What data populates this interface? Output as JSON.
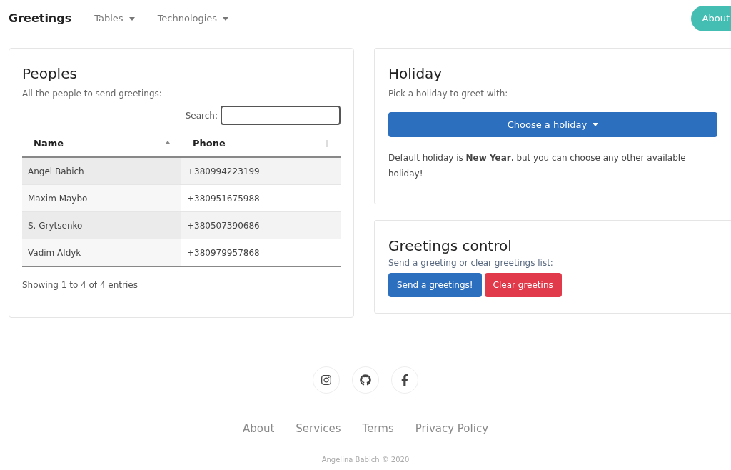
{
  "navbar": {
    "brand": "Greetings",
    "menus": [
      {
        "label": "Tables"
      },
      {
        "label": "Technologies"
      }
    ],
    "about_button": "About"
  },
  "peoples": {
    "title": "Peoples",
    "subtitle": "All the people to send greetings:",
    "search": {
      "label": "Search:"
    },
    "columns": [
      {
        "label": "Name",
        "sorted": true
      },
      {
        "label": "Phone",
        "sorted": false
      }
    ],
    "rows": [
      {
        "name": "Angel Babich",
        "phone": "+380994223199"
      },
      {
        "name": "Maxim Maybo",
        "phone": "+380951675988"
      },
      {
        "name": "S. Grytsenko",
        "phone": "+380507390686"
      },
      {
        "name": "Vadim Aldyk",
        "phone": "+380979957868"
      }
    ],
    "info": "Showing 1 to 4 of 4 entries"
  },
  "holiday": {
    "title": "Holiday",
    "subtitle": "Pick a holiday to greet with:",
    "dropdown": "Choose a holiday",
    "note": "Default holiday is **New Year**, but you can choose any other available holiday!"
  },
  "greetings_control": {
    "title": "Greetings control",
    "subtitle": "Send a greeting or clear greetings list:",
    "buttons": [
      {
        "label": "Send a greetings!",
        "kind": "primary"
      },
      {
        "label": "Clear greetins",
        "kind": "danger"
      }
    ]
  },
  "footer": {
    "links": [
      "About",
      "Services",
      "Terms",
      "Privacy Policy"
    ],
    "copyright": "Angelina Babich © 2020"
  }
}
